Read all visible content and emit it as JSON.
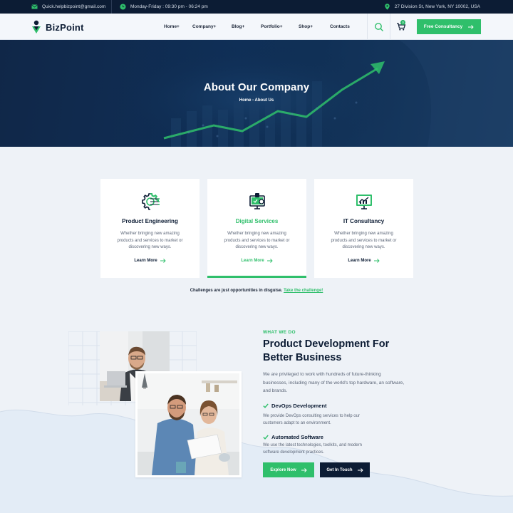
{
  "topbar": {
    "email": "Quick.helpbizpoint@gmail.com",
    "hours": "Monday-Friday : 09:30 pm - 06:24 pm",
    "address": "27 Division St, New York, NY 10002, USA"
  },
  "header": {
    "logo": "BizPoint",
    "nav": [
      "Home+",
      "Company+",
      "Blog+",
      "Portfolio+",
      "Shop+",
      "Contacts"
    ],
    "cart_count": "0",
    "cta_label": "Free Consultancy"
  },
  "hero": {
    "title": "About Our Company",
    "breadcrumb": "Home - About Us"
  },
  "services": [
    {
      "title": "Product Engineering",
      "text": "Whether bringing new amazing products and services to market or discovering new ways.",
      "link": "Learn More",
      "icon": "gear-circuit-icon"
    },
    {
      "title": "Digital Services",
      "text": "Whether bringing new amazing products and services to market or discovering new ways.",
      "link": "Learn More",
      "icon": "digital-services-icon"
    },
    {
      "title": "IT Consultancy",
      "text": "Whether bringing new amazing products and services to market or discovering new ways.",
      "link": "Learn More",
      "icon": "monitor-chart-icon"
    }
  ],
  "challenge": {
    "text": "Challenges are just opportunities in disguise.",
    "link": "Take the challenge!"
  },
  "about": {
    "eyebrow": "WHAT WE DO",
    "title": "Product Development For Better Business",
    "text": "We are privileged to work with hundreds of future-thinking businesses, including many of the world's top hardware, an software, and brands.",
    "features": [
      {
        "title": "DevOps Development",
        "text": "We provide DevOps consulting services to help our customers adapt to an environment."
      },
      {
        "title": "Automated Software",
        "text": "We use the latest technologies, toolkits, and modern software development practices."
      }
    ],
    "btn_primary": "Explore Now",
    "btn_secondary": "Get In Touch"
  },
  "colors": {
    "accent": "#2fbf6b",
    "dark": "#0c1c34"
  }
}
